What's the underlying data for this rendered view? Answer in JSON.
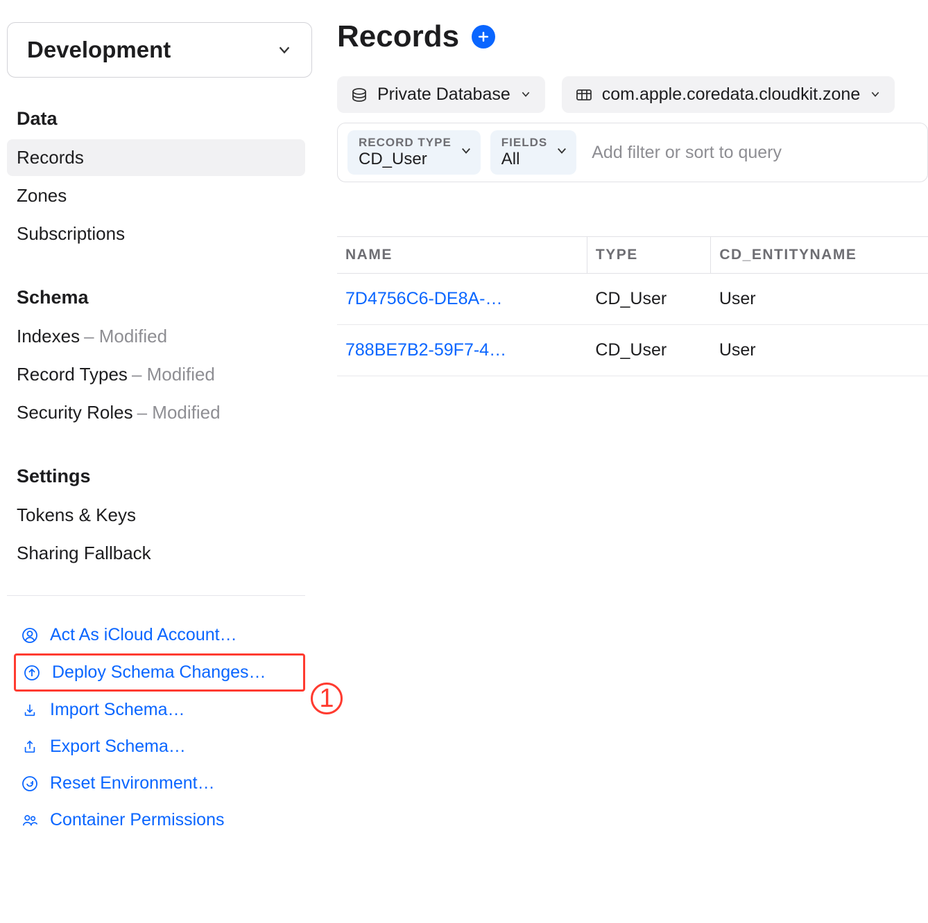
{
  "sidebar": {
    "environment": "Development",
    "sections": {
      "data": {
        "title": "Data",
        "items": [
          {
            "label": "Records",
            "active": true
          },
          {
            "label": "Zones",
            "active": false
          },
          {
            "label": "Subscriptions",
            "active": false
          }
        ]
      },
      "schema": {
        "title": "Schema",
        "items": [
          {
            "label": "Indexes",
            "suffix": " – Modified"
          },
          {
            "label": "Record Types",
            "suffix": " – Modified"
          },
          {
            "label": "Security Roles",
            "suffix": " – Modified"
          }
        ]
      },
      "settings": {
        "title": "Settings",
        "items": [
          {
            "label": "Tokens & Keys"
          },
          {
            "label": "Sharing Fallback"
          }
        ]
      }
    },
    "actions": [
      {
        "label": "Act As iCloud Account…",
        "icon": "user-circle-icon",
        "highlight": false
      },
      {
        "label": "Deploy Schema Changes…",
        "icon": "upload-circle-icon",
        "highlight": true
      },
      {
        "label": "Import Schema…",
        "icon": "download-tray-icon",
        "highlight": false
      },
      {
        "label": "Export Schema…",
        "icon": "upload-tray-icon",
        "highlight": false
      },
      {
        "label": "Reset Environment…",
        "icon": "reset-circle-icon",
        "highlight": false
      },
      {
        "label": "Container Permissions",
        "icon": "people-icon",
        "highlight": false
      }
    ]
  },
  "annotation": {
    "number": "1"
  },
  "main": {
    "title": "Records",
    "database_pill": "Private Database",
    "zone_pill": "com.apple.coredata.cloudkit.zone",
    "record_type": {
      "label": "RECORD TYPE",
      "value": "CD_User"
    },
    "fields": {
      "label": "FIELDS",
      "value": "All"
    },
    "filter_placeholder": "Add filter or sort to query",
    "table": {
      "columns": [
        "NAME",
        "TYPE",
        "CD_ENTITYNAME"
      ],
      "rows": [
        {
          "name": "7D4756C6-DE8A-…",
          "type": "CD_User",
          "entity": "User"
        },
        {
          "name": "788BE7B2-59F7-4…",
          "type": "CD_User",
          "entity": "User"
        }
      ]
    }
  }
}
